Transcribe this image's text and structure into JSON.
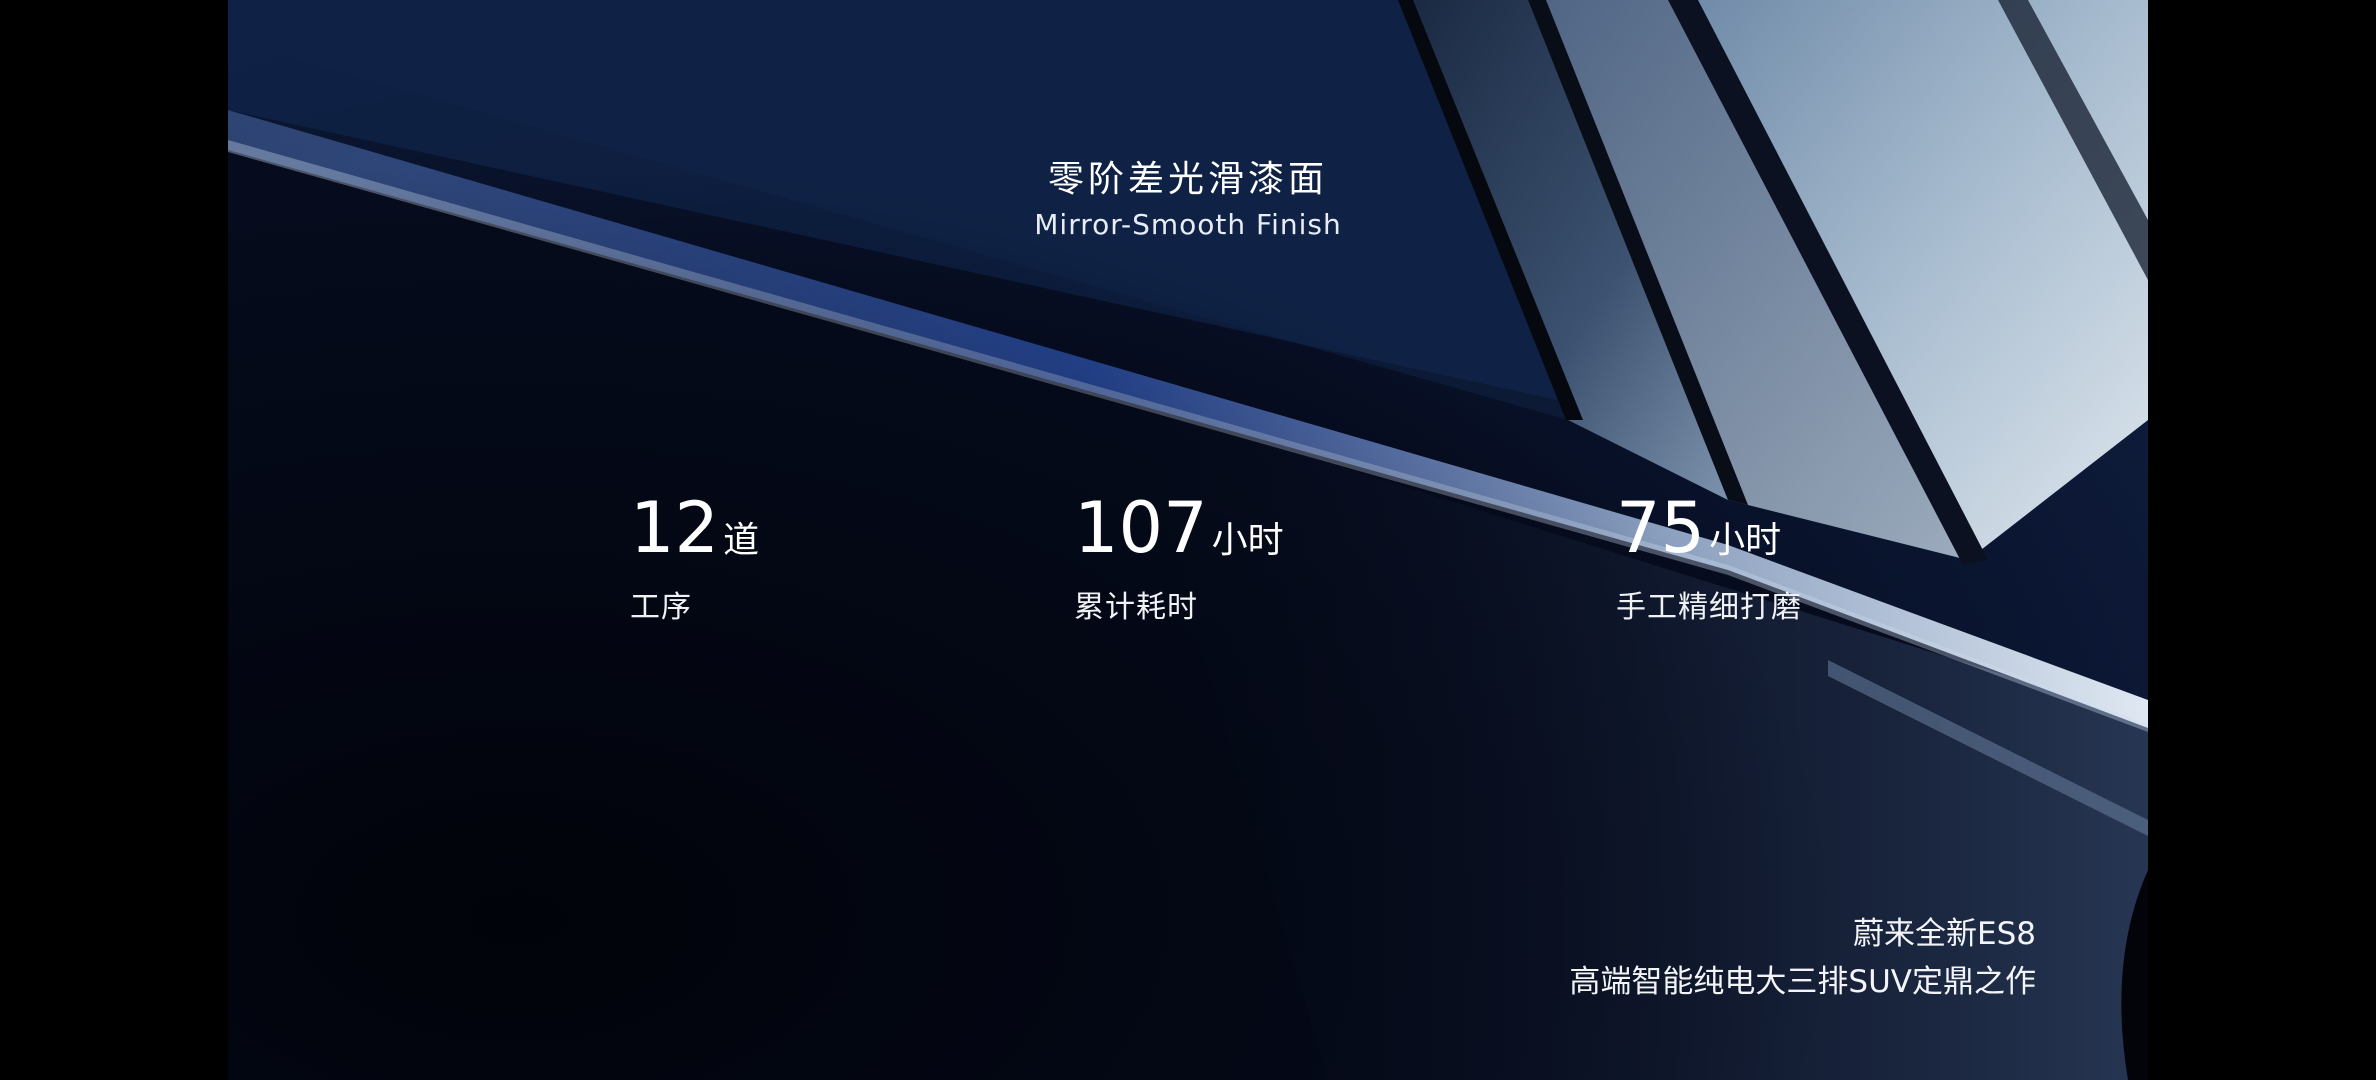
{
  "screen": {
    "background": "#000000"
  },
  "video": {
    "headline_cn": "零阶差光滑漆面",
    "headline_en": "Mirror-Smooth Finish",
    "stats": [
      {
        "number": "12",
        "unit": "道",
        "description": "工序"
      },
      {
        "number": "107",
        "unit": "小时",
        "description": "累计耗时"
      },
      {
        "number": "75",
        "unit": "小时",
        "description": "手工精细打磨"
      }
    ],
    "caption_line1": "蔚来全新ES8",
    "caption_line2": "高端智能纯电大三排SUV定鼎之作",
    "accent_color": "#1e3a8a",
    "sky_color": "#b8c8d8"
  }
}
